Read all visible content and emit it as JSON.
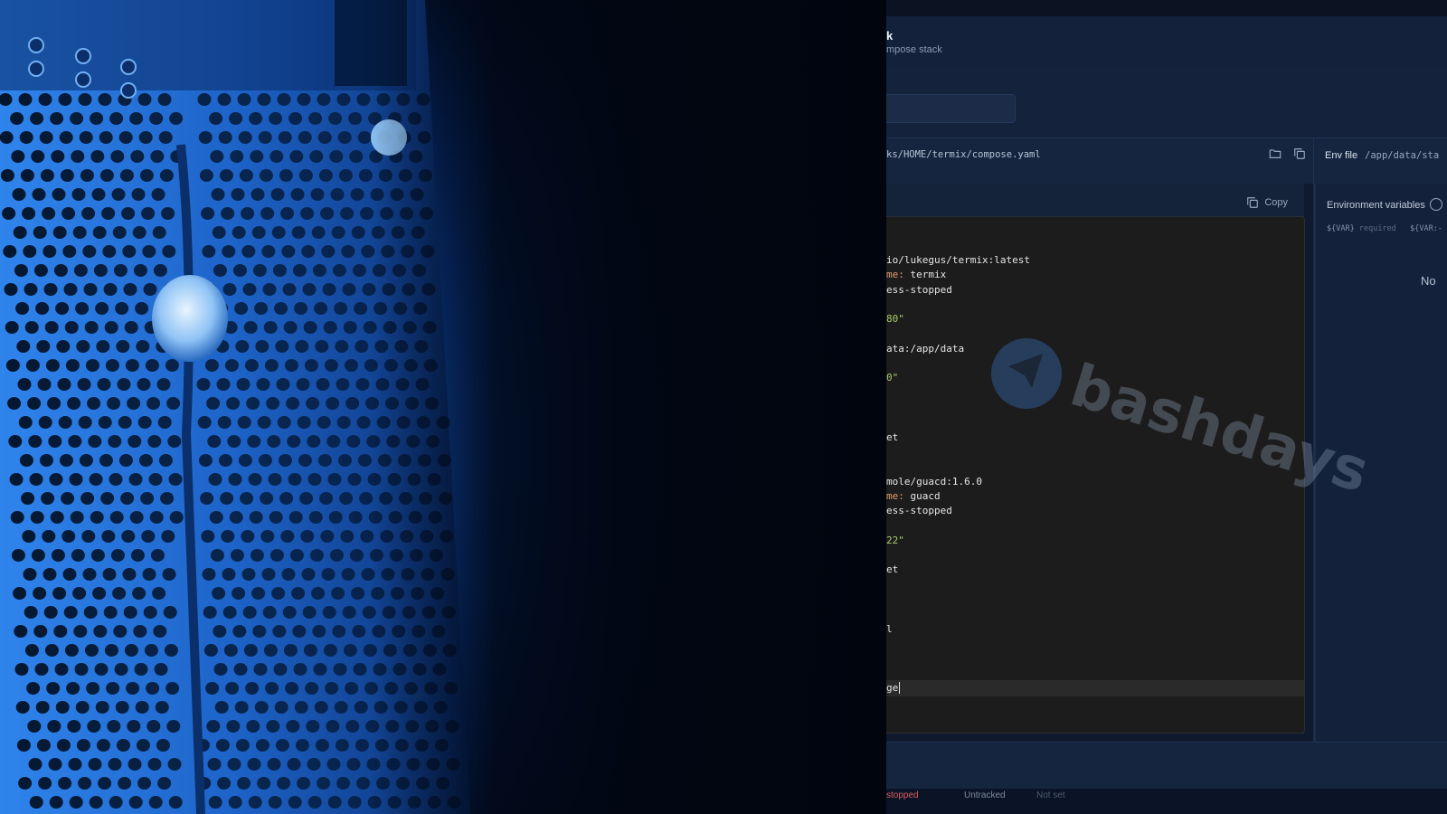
{
  "photo": {
    "watermark": "bashdays"
  },
  "app": {
    "header": {
      "title": "k",
      "subtitle": "mpose stack"
    },
    "path_bar": {
      "compose_path": "ks/HOME/termix/compose.yaml",
      "env_file_label": "Env file",
      "env_file_path": "/app/data/sta"
    },
    "editor": {
      "copy_label": "Copy",
      "lines": [
        {
          "pre": "io/lukegus/termix:latest",
          "key": "",
          "val": "",
          "type": "plain"
        },
        {
          "pre": "",
          "key": "me:",
          "val": " termix",
          "type": "kv"
        },
        {
          "pre": "ess-stopped",
          "key": "",
          "val": "",
          "type": "plain"
        },
        {
          "pre": "",
          "key": "",
          "val": "",
          "type": "blank"
        },
        {
          "pre": "",
          "key": "",
          "val": "80\"",
          "type": "str"
        },
        {
          "pre": "",
          "key": "",
          "val": "",
          "type": "blank"
        },
        {
          "pre": "ata:/app/data",
          "key": "",
          "val": "",
          "type": "plain"
        },
        {
          "pre": "",
          "key": "",
          "val": "",
          "type": "blank"
        },
        {
          "pre": "",
          "key": "",
          "val": "0\"",
          "type": "str"
        },
        {
          "pre": "",
          "key": "",
          "val": "",
          "type": "blank"
        },
        {
          "pre": "",
          "key": "",
          "val": "",
          "type": "blank"
        },
        {
          "pre": "",
          "key": "",
          "val": "",
          "type": "blank"
        },
        {
          "pre": "et",
          "key": "",
          "val": "",
          "type": "plain"
        },
        {
          "pre": "",
          "key": "",
          "val": "",
          "type": "blank"
        },
        {
          "pre": "",
          "key": "",
          "val": "",
          "type": "blank"
        },
        {
          "pre": "mole/guacd:1.6.0",
          "key": "",
          "val": "",
          "type": "plain"
        },
        {
          "pre": "",
          "key": "me:",
          "val": " guacd",
          "type": "kv"
        },
        {
          "pre": "ess-stopped",
          "key": "",
          "val": "",
          "type": "plain"
        },
        {
          "pre": "",
          "key": "",
          "val": "",
          "type": "blank"
        },
        {
          "pre": "",
          "key": "",
          "val": "22\"",
          "type": "str"
        },
        {
          "pre": "",
          "key": "",
          "val": "",
          "type": "blank"
        },
        {
          "pre": "et",
          "key": "",
          "val": "",
          "type": "plain"
        },
        {
          "pre": "",
          "key": "",
          "val": "",
          "type": "blank"
        },
        {
          "pre": "",
          "key": "",
          "val": "",
          "type": "blank"
        },
        {
          "pre": "",
          "key": "",
          "val": "",
          "type": "blank"
        },
        {
          "pre": "l",
          "key": "",
          "val": "",
          "type": "plain"
        },
        {
          "pre": "",
          "key": "",
          "val": "",
          "type": "blank"
        },
        {
          "pre": "",
          "key": "",
          "val": "",
          "type": "blank"
        },
        {
          "pre": "",
          "key": "",
          "val": "",
          "type": "blank"
        },
        {
          "pre": "ge",
          "key": "",
          "val": "",
          "type": "active"
        }
      ]
    },
    "env_panel": {
      "label": "Environment variables",
      "hint_required": "${VAR}",
      "hint_required_word": "required",
      "hint_default": "${VAR:-",
      "empty_text": "No"
    },
    "status": {
      "state": "stopped",
      "tracking": "Untracked",
      "extra": "Not set"
    },
    "icons": {
      "folder": "folder-icon",
      "copy_path": "copy-icon",
      "copy_editor": "copy-icon",
      "info": "info-icon"
    },
    "colors": {
      "key": "#e39a6b",
      "string": "#a6cc6e",
      "stopped": "#e05b5b"
    }
  }
}
